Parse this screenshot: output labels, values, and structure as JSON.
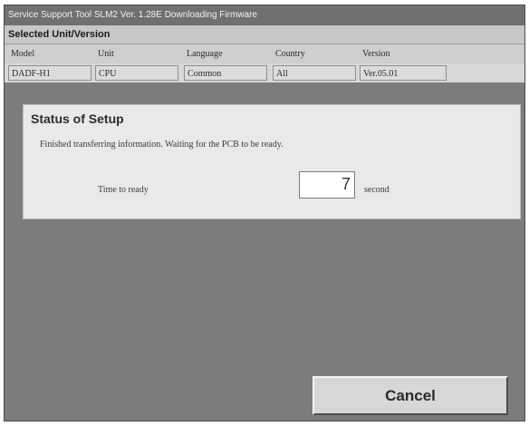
{
  "window": {
    "title": "Service Support Tool SLM2 Ver. 1.28E  Downloading Firmware"
  },
  "selected_unit": {
    "heading": "Selected Unit/Version",
    "columns": [
      "Model",
      "Unit",
      "Language",
      "Country",
      "Version"
    ],
    "values": [
      "DADF-H1",
      "CPU",
      "Common",
      "All",
      "Ver.05.01"
    ]
  },
  "status": {
    "title": "Status of Setup",
    "message": "Finished transferring information. Waiting for the PCB to be ready.",
    "time_label": "Time to ready",
    "time_value": "7",
    "unit_label": "second"
  },
  "buttons": {
    "cancel_label": "Cancel"
  },
  "colors": {
    "window_background": "#7c7c7c",
    "panel_background": "#e9e9e9",
    "header_background": "#c7c7c7"
  }
}
